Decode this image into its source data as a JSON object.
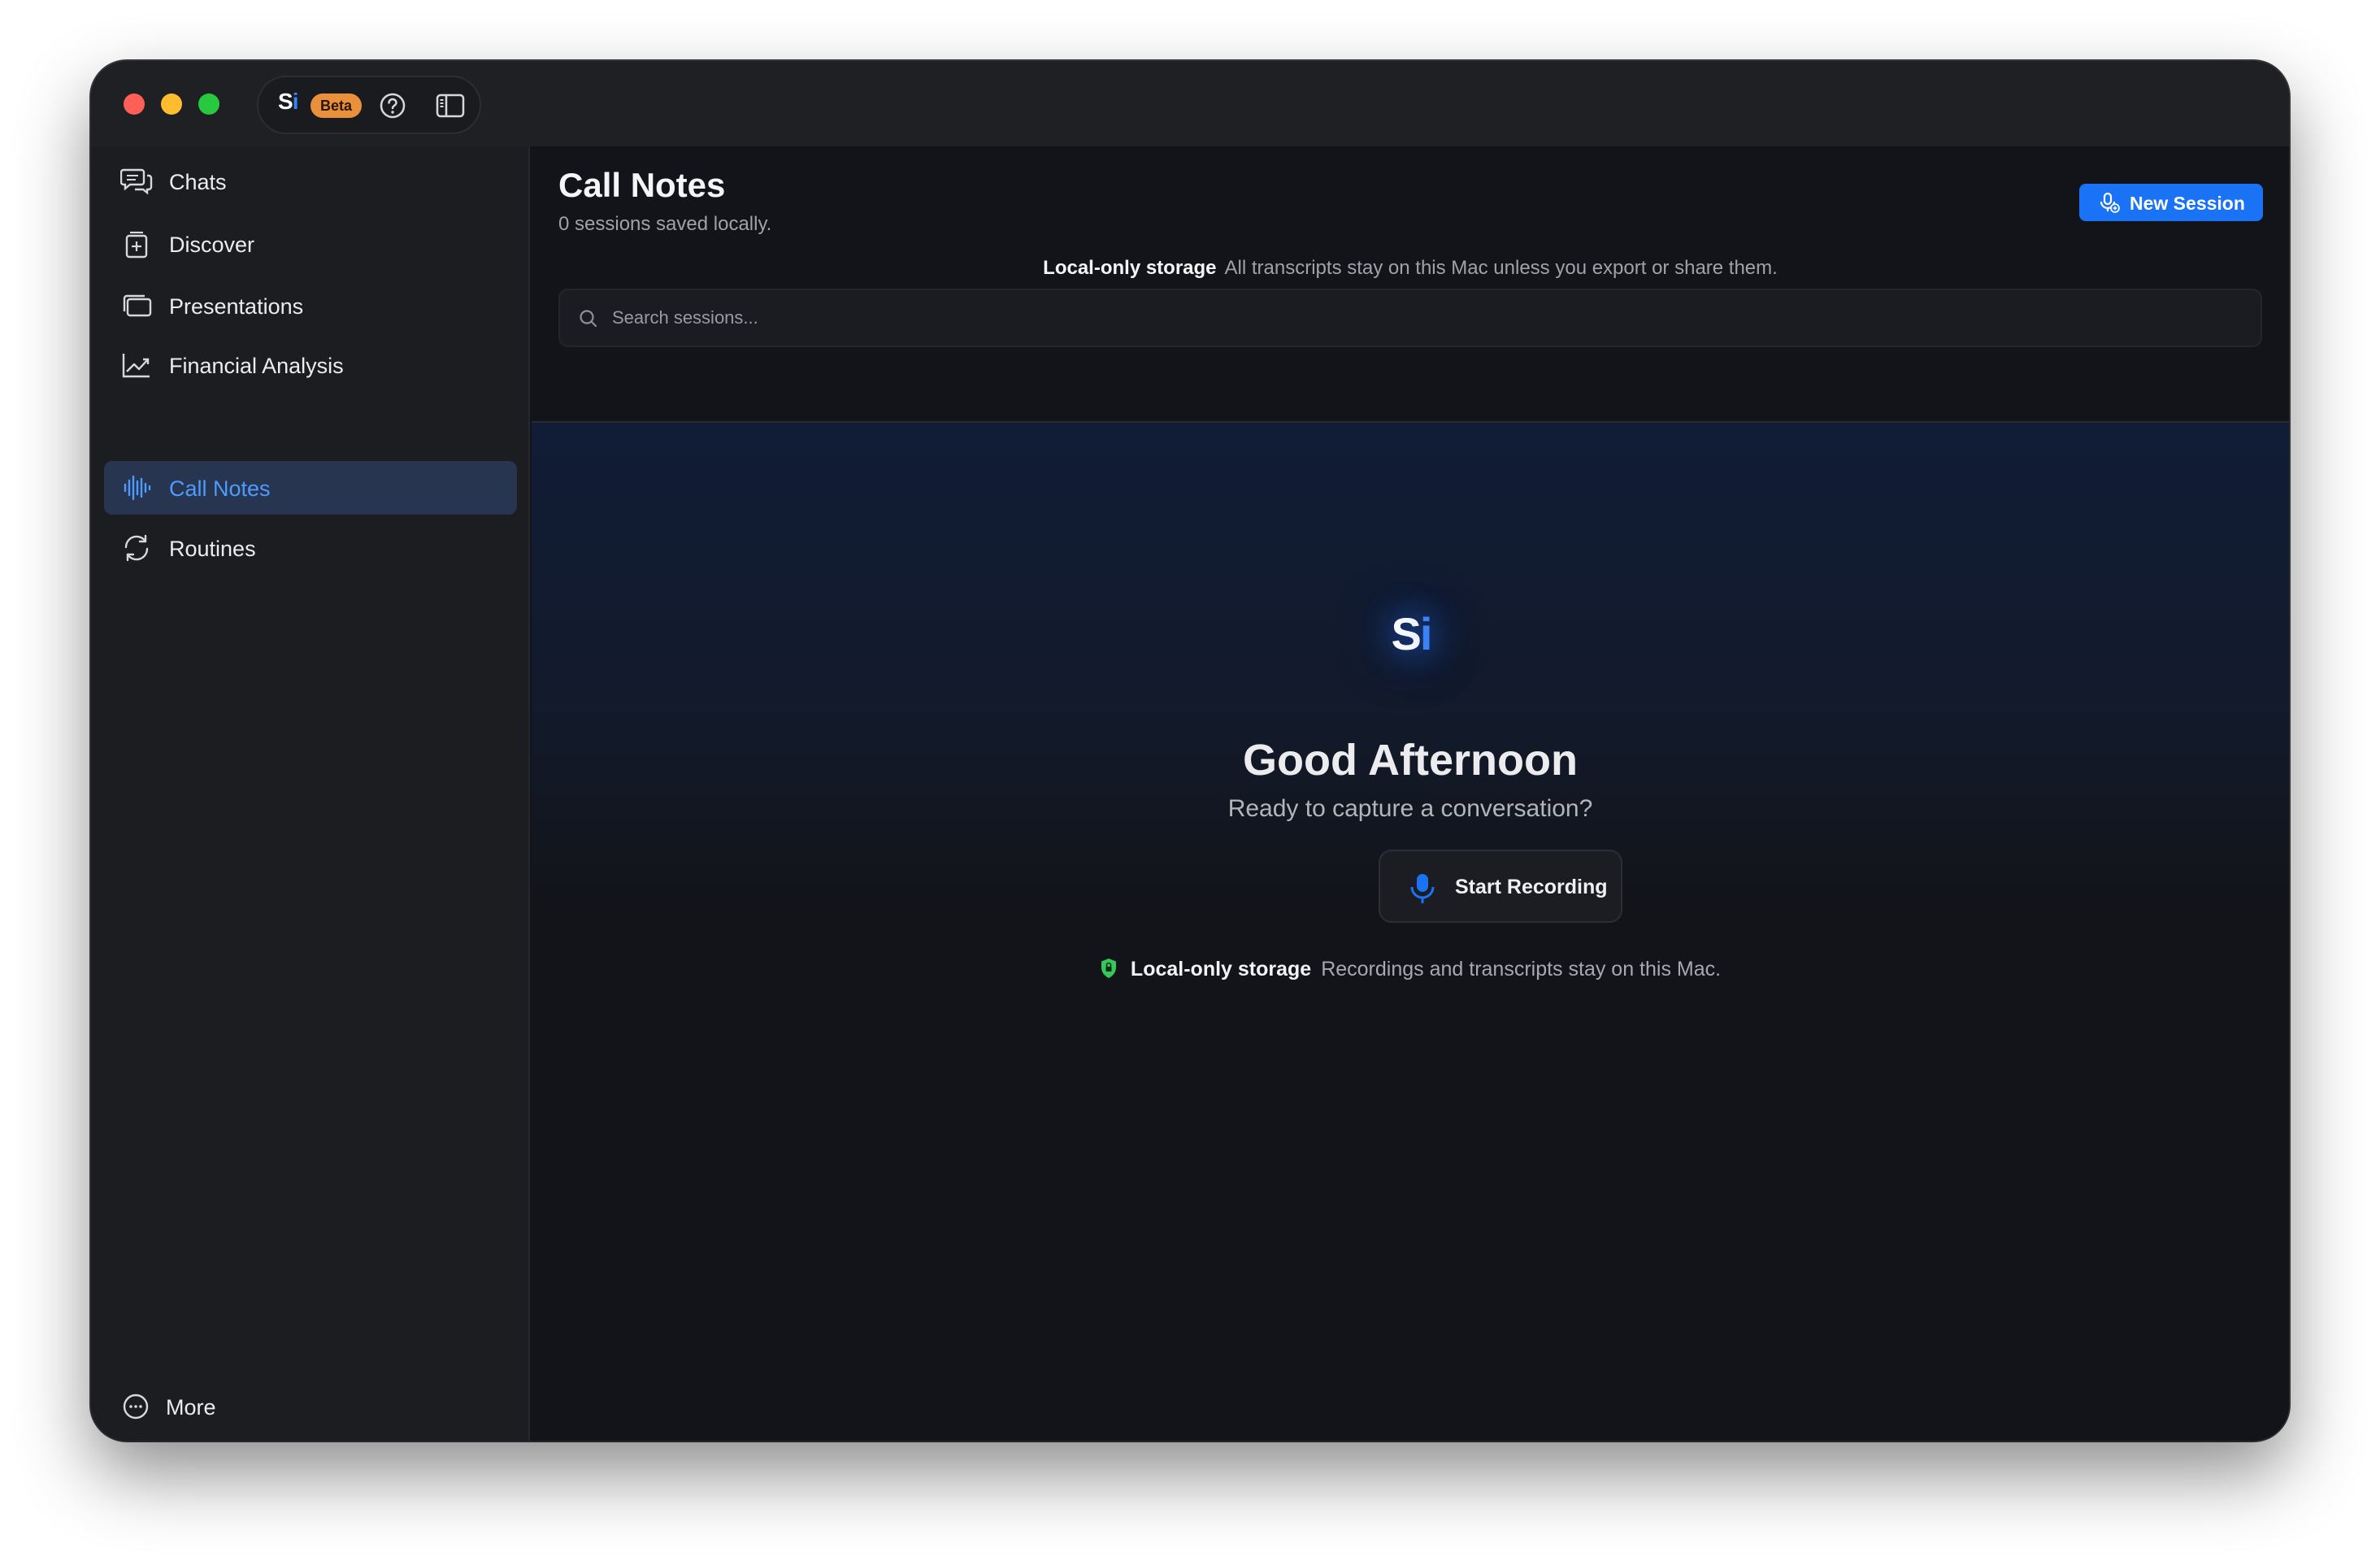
{
  "titlebar": {
    "logo_s": "S",
    "logo_i": "i",
    "beta_label": "Beta"
  },
  "sidebar": {
    "items": [
      {
        "label": "Chats",
        "icon": "chat-bubbles-icon"
      },
      {
        "label": "Discover",
        "icon": "discover-icon"
      },
      {
        "label": "Presentations",
        "icon": "presentations-icon"
      },
      {
        "label": "Financial Analysis",
        "icon": "chart-line-icon"
      },
      {
        "label": "Call Notes",
        "icon": "waveform-icon",
        "active": true
      },
      {
        "label": "Routines",
        "icon": "refresh-icon"
      }
    ],
    "more_label": "More"
  },
  "main": {
    "title": "Call Notes",
    "subtitle": "0 sessions saved locally.",
    "new_session_label": "New Session",
    "storage_bold": "Local-only storage",
    "storage_text": "All transcripts stay on this Mac unless you export or share them.",
    "search_placeholder": "Search sessions..."
  },
  "hero": {
    "logo_s": "S",
    "logo_i": "i",
    "greeting": "Good Afternoon",
    "prompt": "Ready to capture a conversation?",
    "start_recording_label": "Start Recording",
    "storage_bold": "Local-only storage",
    "storage_text": "Recordings and transcripts stay on this Mac."
  },
  "colors": {
    "accent": "#1a73f5",
    "active_nav_bg": "#283550",
    "active_nav_text": "#4d9bff",
    "beta_badge": "#e8913a",
    "shield_green": "#34c759"
  }
}
